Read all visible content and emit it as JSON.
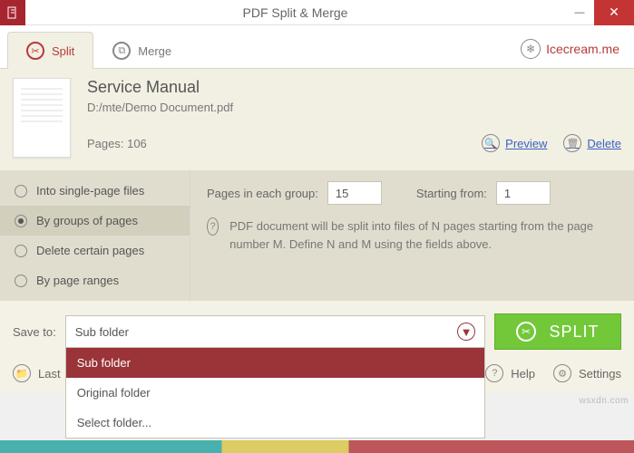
{
  "window": {
    "title": "PDF Split & Merge"
  },
  "tabs": {
    "split": "Split",
    "merge": "Merge"
  },
  "brand": {
    "label": "Icecream.me"
  },
  "document": {
    "title": "Service Manual",
    "path": "D:/mte/Demo Document.pdf",
    "pages_label": "Pages: 106",
    "preview": "Preview",
    "delete": "Delete"
  },
  "split_modes": {
    "single": "Into single-page files",
    "groups": "By groups of pages",
    "delete": "Delete certain pages",
    "ranges": "By page ranges"
  },
  "groups_panel": {
    "pages_each_label": "Pages in each group:",
    "pages_each_value": "15",
    "starting_label": "Starting from:",
    "starting_value": "1",
    "info": "PDF document will be split into files of N pages starting from the page number M. Define N and M using the fields above."
  },
  "save": {
    "label": "Save to:",
    "selected": "Sub folder",
    "options": [
      "Sub folder",
      "Original folder",
      "Select folder..."
    ]
  },
  "actions": {
    "split": "SPLIT",
    "last": "Last",
    "help": "Help",
    "settings": "Settings"
  },
  "watermark": "wsxdn.com"
}
